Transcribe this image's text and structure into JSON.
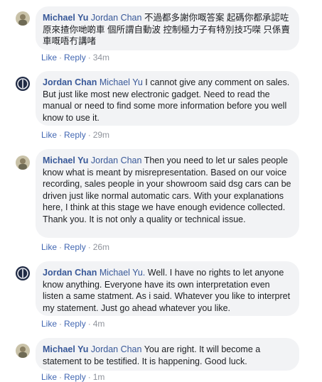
{
  "comments": [
    {
      "author": "Michael Yu",
      "mention": "Jordan Chan",
      "text": "不過都多謝你嘅答案 起碼你都承認咗 原來揸你哋啲車 個所謂自動波 控制極力子有特別技巧㗎 只係賣車嘅唔冇講啫",
      "like": "Like",
      "reply": "Reply",
      "time": "34m",
      "avatar": "michael-avatar"
    },
    {
      "author": "Jordan Chan",
      "mention": "Michael Yu",
      "text": "I cannot give any comment on sales. But just like most new electronic gadget. Need to read the manual or need to find some more information before you well know to use it.",
      "like": "Like",
      "reply": "Reply",
      "time": "29m",
      "avatar": "jordan-avatar"
    },
    {
      "author": "Michael Yu",
      "mention": "Jordan Chan",
      "text": "Then you need to let ur sales people know what is meant by misrepresentation. Based on our voice recording, sales people in your showroom said dsg cars can be driven just like normal automatic cars. With your explanations here, I think at this stage we have enough evidence collected. Thank you. It is not only a quality or technical issue.",
      "like": "Like",
      "reply": "Reply",
      "time": "26m",
      "avatar": "michael-avatar"
    },
    {
      "author": "Jordan Chan",
      "mention": "Michael Yu.",
      "text": "Well. I have no rights to let anyone know anything. Everyone have its own interpretation even listen a same statment. As i said. Whatever you like to interpret my statement. Just go ahead whatever you like.",
      "like": "Like",
      "reply": "Reply",
      "time": "4m",
      "avatar": "jordan-avatar"
    },
    {
      "author": "Michael Yu",
      "mention": "Jordan Chan",
      "text": "You are right. It will become a statement to be testified. It is happening. Good luck.",
      "like": "Like",
      "reply": "Reply",
      "time": "1m",
      "avatar": "michael-avatar"
    }
  ],
  "separator": "·",
  "colors": {
    "bubble": "#f2f3f5",
    "name": "#385898",
    "link": "#4267b2",
    "meta": "#90949c"
  }
}
